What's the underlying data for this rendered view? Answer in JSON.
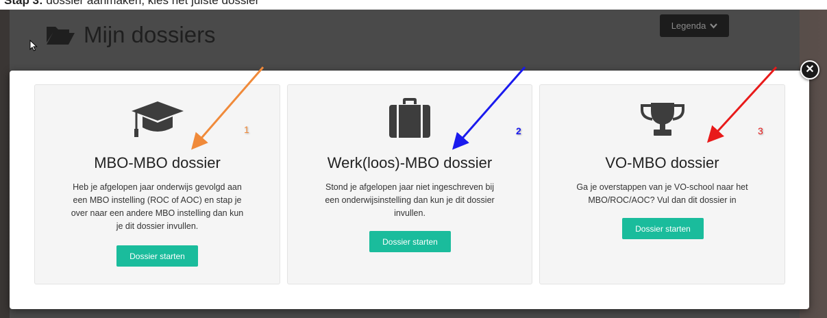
{
  "top_strip": {
    "text_bold": "Stap 3:",
    "text_rest": " dossier aanmaken, kies het juiste dossier"
  },
  "page": {
    "title": "Mijn dossiers",
    "title_icon": "folder-open-icon"
  },
  "legend": {
    "label": "Legenda",
    "icon": "chevron-down-icon"
  },
  "modal": {
    "close_icon": "close-icon",
    "cards": [
      {
        "icon": "graduation-cap-icon",
        "number": "1",
        "number_color": "#f08a3a",
        "title": "MBO-MBO dossier",
        "desc": [
          "Heb je afgelopen jaar onderwijs gevolgd aan",
          "een MBO instelling (ROC of AOC) en stap je",
          "over naar een andere MBO instelling dan kun",
          "je dit dossier invullen."
        ],
        "button": "Dossier starten"
      },
      {
        "icon": "briefcase-icon",
        "number": "2",
        "number_color": "#1a1aee",
        "title": "Werk(loos)-MBO dossier",
        "desc": [
          "Stond je afgelopen jaar niet ingeschreven bij",
          "een onderwijsinstelling dan kun je dit dossier",
          "invullen."
        ],
        "button": "Dossier starten"
      },
      {
        "icon": "trophy-icon",
        "number": "3",
        "number_color": "#e81a1a",
        "title": "VO-MBO dossier",
        "desc": [
          "Ga je overstappen van je VO-school naar het",
          "MBO/ROC/AOC? Vul dan dit dossier in"
        ],
        "button": "Dossier starten"
      }
    ]
  },
  "annotation_arrows": [
    {
      "color": "#f08a3a",
      "target": "card-1-title"
    },
    {
      "color": "#1a1aee",
      "target": "card-2-title"
    },
    {
      "color": "#e81a1a",
      "target": "card-3-title"
    }
  ],
  "colors": {
    "accent": "#1abc9c",
    "overlay": "#4a4a4a",
    "card_bg": "#f5f5f5"
  }
}
